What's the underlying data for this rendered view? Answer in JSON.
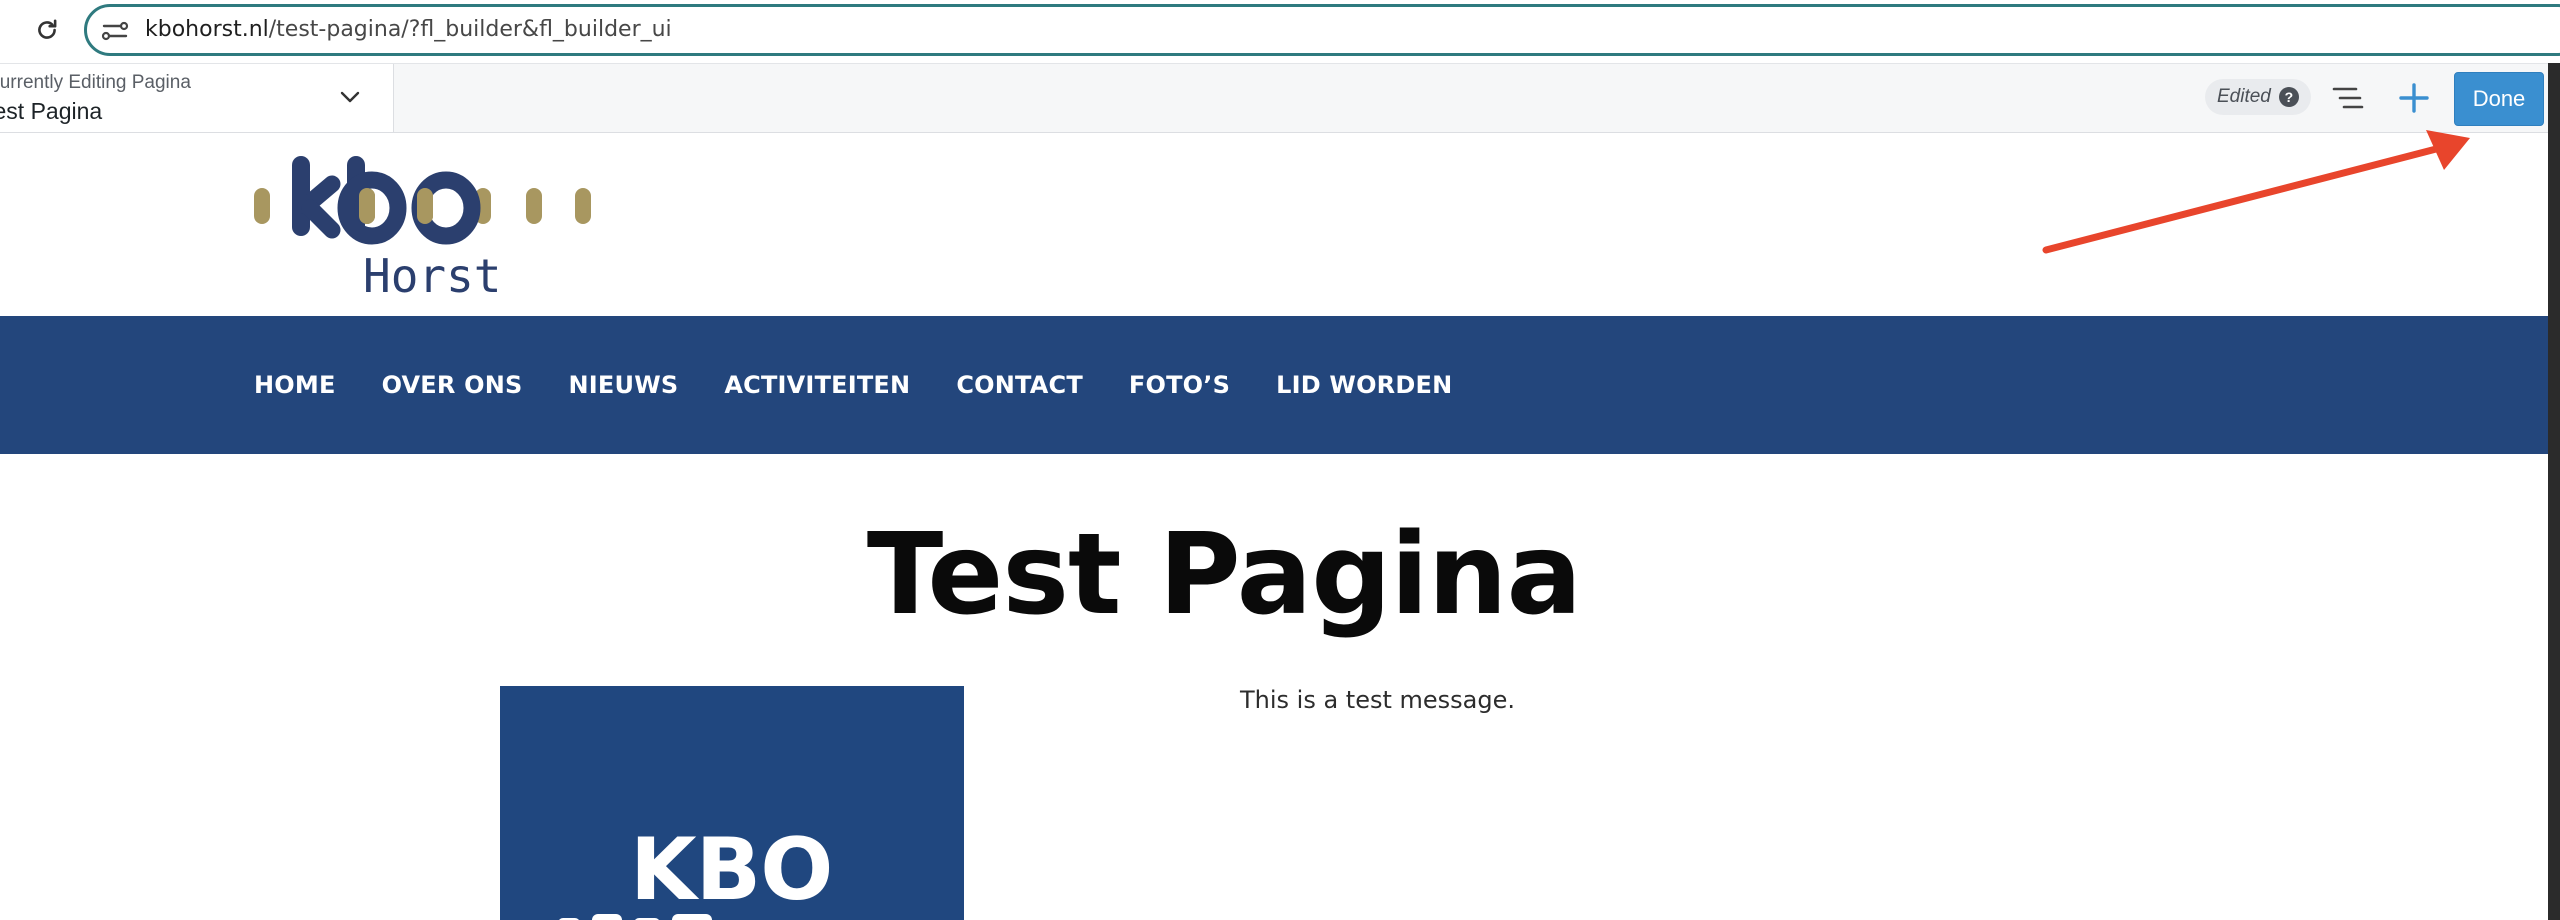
{
  "browser": {
    "url_host": "kbohorst.nl",
    "url_path": "/test-pagina/?fl_builder&fl_builder_ui"
  },
  "builder": {
    "editing_label": "Currently Editing Pagina",
    "editing_title": "Test Pagina",
    "edited_label": "Edited",
    "help_glyph": "?",
    "done_label": "Done"
  },
  "site": {
    "logo_wordmark": "kbo",
    "logo_sub": "Horst",
    "nav": [
      "HOME",
      "OVER ONS",
      "NIEUWS",
      "ACTIVITEITEN",
      "CONTACT",
      "FOTO’S",
      "LID WORDEN"
    ]
  },
  "content": {
    "title": "Test Pagina",
    "image_text": "KBO",
    "message": "This is a test message."
  },
  "colors": {
    "nav_background": "#23467c",
    "done_button": "#3a8fd0",
    "logo_navy": "#2b3f6e",
    "logo_gold": "#a89760",
    "arrow": "#e8452c"
  },
  "icons": [
    "reload-icon",
    "site-info-icon",
    "chevron-down-icon",
    "help-icon",
    "outline-list-icon",
    "plus-icon"
  ]
}
